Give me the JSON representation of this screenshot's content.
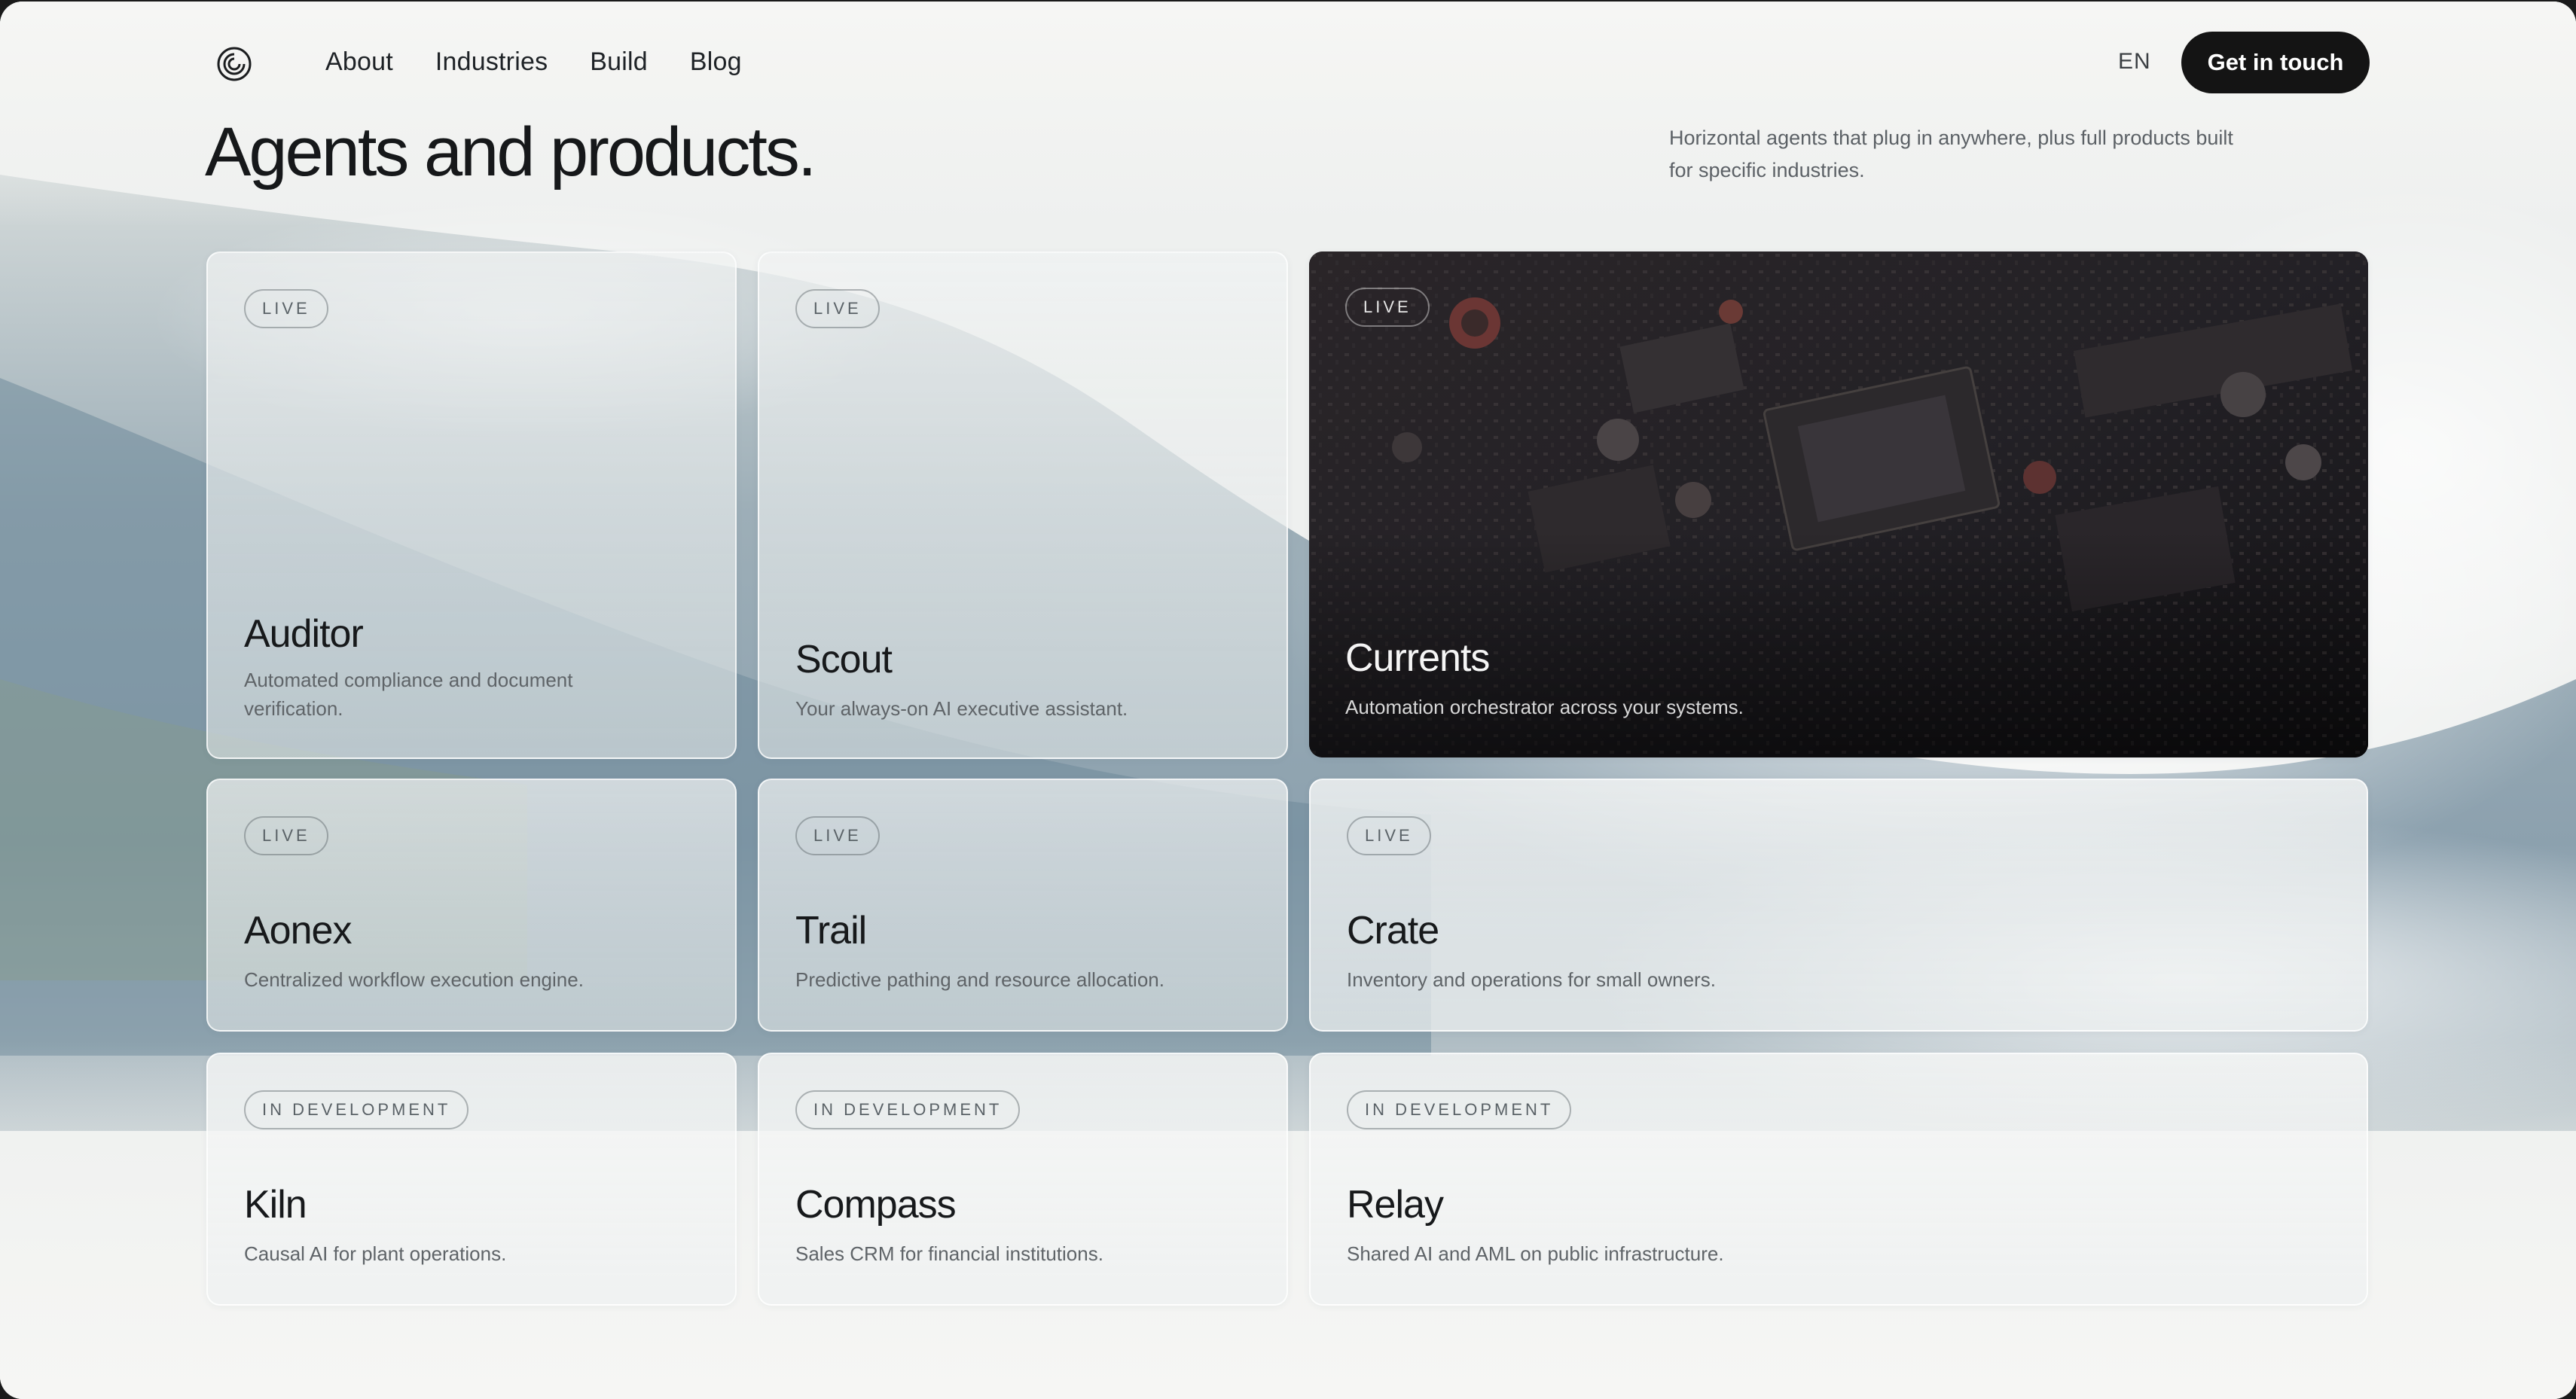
{
  "nav": {
    "links": [
      "About",
      "Industries",
      "Build",
      "Blog"
    ],
    "language": "EN",
    "cta_label": "Get in touch"
  },
  "hero": {
    "title": "Agents and products.",
    "intro": "Horizontal agents that plug in anywhere, plus full products built for specific industries."
  },
  "cards": [
    {
      "status": "LIVE",
      "name": "Auditor",
      "description": "Automated compliance and document verification."
    },
    {
      "status": "LIVE",
      "name": "Scout",
      "description": "Your always-on AI executive assistant."
    },
    {
      "status": "LIVE",
      "name": "Currents",
      "description": "Automation orchestrator across your systems."
    },
    {
      "status": "LIVE",
      "name": "Aonex",
      "description": "Centralized workflow execution engine."
    },
    {
      "status": "LIVE",
      "name": "Trail",
      "description": "Predictive pathing and resource allocation."
    },
    {
      "status": "LIVE",
      "name": "Crate",
      "description": "Inventory and operations for small owners."
    },
    {
      "status": "IN DEVELOPMENT",
      "name": "Kiln",
      "description": "Causal AI for plant operations."
    },
    {
      "status": "IN DEVELOPMENT",
      "name": "Compass",
      "description": "Sales CRM for financial institutions."
    },
    {
      "status": "IN DEVELOPMENT",
      "name": "Relay",
      "description": "Shared AI and AML on public infrastructure."
    }
  ],
  "colors": {
    "cta_background": "#141414",
    "page_background": "#f6f6f4",
    "ocean": "#7f98a6"
  },
  "icons": {
    "logo": "spiral-logo-icon"
  }
}
